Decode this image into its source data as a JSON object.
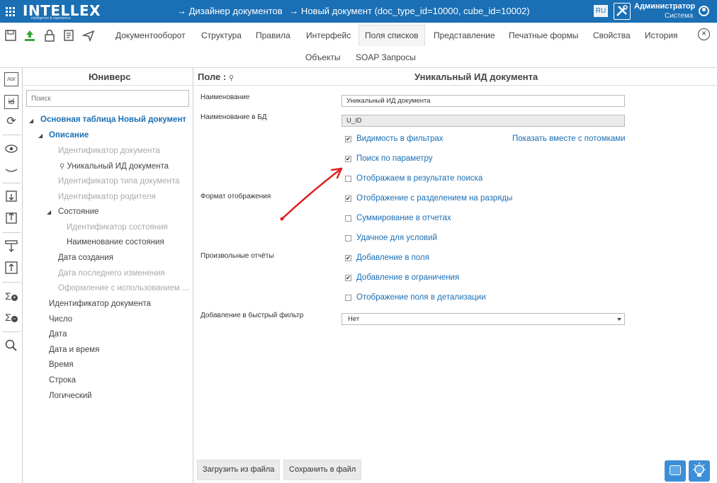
{
  "app": {
    "logo_main": "INTELLEX",
    "logo_sub": "intelligence & experience",
    "breadcrumb": [
      "→ Дизайнер документов",
      "→ Новый документ (doc_type_id=10000, cube_id=10002)"
    ],
    "lang": "RU",
    "user_name": "Администратор",
    "user_role": "Система"
  },
  "menu": {
    "tabs": [
      "Документооборот",
      "Структура",
      "Правила",
      "Интерфейс",
      "Поля списков",
      "Представление",
      "Печатные формы",
      "Свойства",
      "История"
    ],
    "active_tab": "Поля списков",
    "subtabs": [
      "Объекты",
      "SOAP Запросы"
    ],
    "close_symbol": "×"
  },
  "strip": {
    "log_label": "лог",
    "id_label": "id",
    "sum_label": "Σ"
  },
  "tree": {
    "title": "Юниверс",
    "search_placeholder": "Поиск",
    "root": "Основная таблица Новый документ",
    "section": "Описание",
    "items": [
      "Идентификатор документа",
      "Уникальный ИД документа",
      "Идентификатор типа документа",
      "Идентификатор родителя",
      "Состояние",
      "Идентификатор состояния",
      "Наименование состояния",
      "Дата создания",
      "Дата последнего изменения",
      "Оформление с использованием ...",
      "Идентификатор документа",
      "Число",
      "Дата",
      "Дата и время",
      "Время",
      "Строка",
      "Логический"
    ]
  },
  "props": {
    "field_label": "Поле :",
    "title": "Уникальный ИД документа",
    "name_label": "Наименование",
    "name_value": "Уникальный ИД документа",
    "db_name_label": "Наименование в БД",
    "db_name_value": "U_ID",
    "show_with_children": "Показать вместе с потомками",
    "display_format_label": "Формат отображения",
    "custom_reports_label": "Произвольные отчёты",
    "quick_filter_label": "Добавление в быстрый фильтр",
    "quick_filter_value": "Нет",
    "checkboxes": [
      {
        "label": "Видимость в фильтрах",
        "checked": true
      },
      {
        "label": "Поиск по параметру",
        "checked": true
      },
      {
        "label": "Отображаем в результате поиска",
        "checked": false
      },
      {
        "label": "Отображение с разделением на разряды",
        "checked": true
      },
      {
        "label": "Суммирование в отчетах",
        "checked": false
      },
      {
        "label": "Удачное для условий",
        "checked": false
      },
      {
        "label": "Добавление в поля",
        "checked": true
      },
      {
        "label": "Добавление в ограничения",
        "checked": true
      },
      {
        "label": "Отображение поля в детализации",
        "checked": false
      }
    ],
    "load_button": "Загрузить из файла",
    "save_button": "Сохранить в файл"
  },
  "colors": {
    "brand": "#1a6fb5",
    "annotation_arrow": "#e02020",
    "fab": "#3c8fd6"
  }
}
